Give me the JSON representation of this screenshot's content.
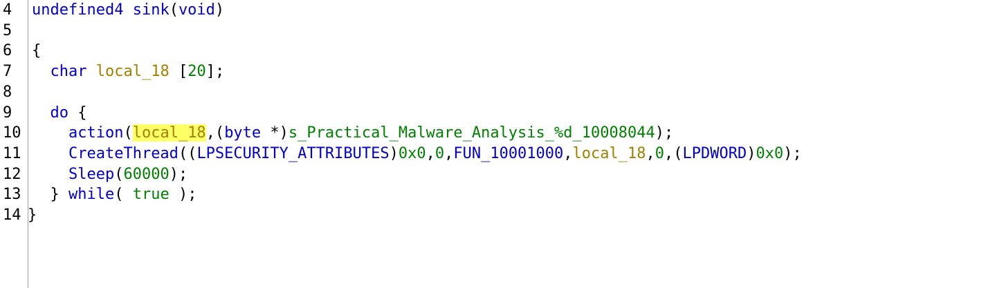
{
  "colors": {
    "keyword": "#0000c8",
    "function": "#0000c8",
    "variable": "#a08000",
    "constant": "#008000",
    "punctuation": "#000000",
    "highlight": "#ffff66",
    "gutter_rule": "#9e9e9e"
  },
  "gutter": {
    "line_numbers": [
      "4",
      "5",
      "6",
      "7",
      "8",
      "9",
      "10",
      "11",
      "12",
      "13",
      "14"
    ]
  },
  "code": {
    "line4": {
      "return_type": "undefined4",
      "func_name": "sink",
      "open_paren": "(",
      "param_type": "void",
      "close_paren": ")"
    },
    "line6": {
      "brace": "{"
    },
    "line7": {
      "indent": "  ",
      "type": "char",
      "var": "local_18",
      "space": " ",
      "open_bracket": "[",
      "size": "20",
      "close": "];"
    },
    "line9": {
      "indent": "  ",
      "keyword": "do",
      "brace": " {"
    },
    "line10": {
      "indent": "    ",
      "func": "action",
      "open_paren": "(",
      "arg1": "local_18",
      "sep1": ",(",
      "cast_type": "byte",
      "cast_ptr": " *)",
      "arg2": "s_Practical_Malware_Analysis_%d_10008044",
      "close": ");"
    },
    "line11": {
      "indent": "    ",
      "func": "CreateThread",
      "open": "((",
      "cast1": "LPSECURITY_ATTRIBUTES",
      "close1": ")",
      "arg1": "0x0",
      "comma1": ",",
      "arg2": "0",
      "comma2": ",",
      "arg3": "FUN_10001000",
      "comma3": ",",
      "arg4": "local_18",
      "comma4": ",",
      "arg5": "0",
      "comma5": ",(",
      "cast2": "LPDWORD",
      "close2": ")",
      "arg6": "0x0",
      "close": ");"
    },
    "line12": {
      "indent": "    ",
      "func": "Sleep",
      "open": "(",
      "arg": "60000",
      "close": ");"
    },
    "line13": {
      "indent": "  ",
      "brace": "} ",
      "keyword": "while",
      "open": "( ",
      "value": "true",
      "close": " );"
    },
    "line14": {
      "brace": "}"
    }
  }
}
